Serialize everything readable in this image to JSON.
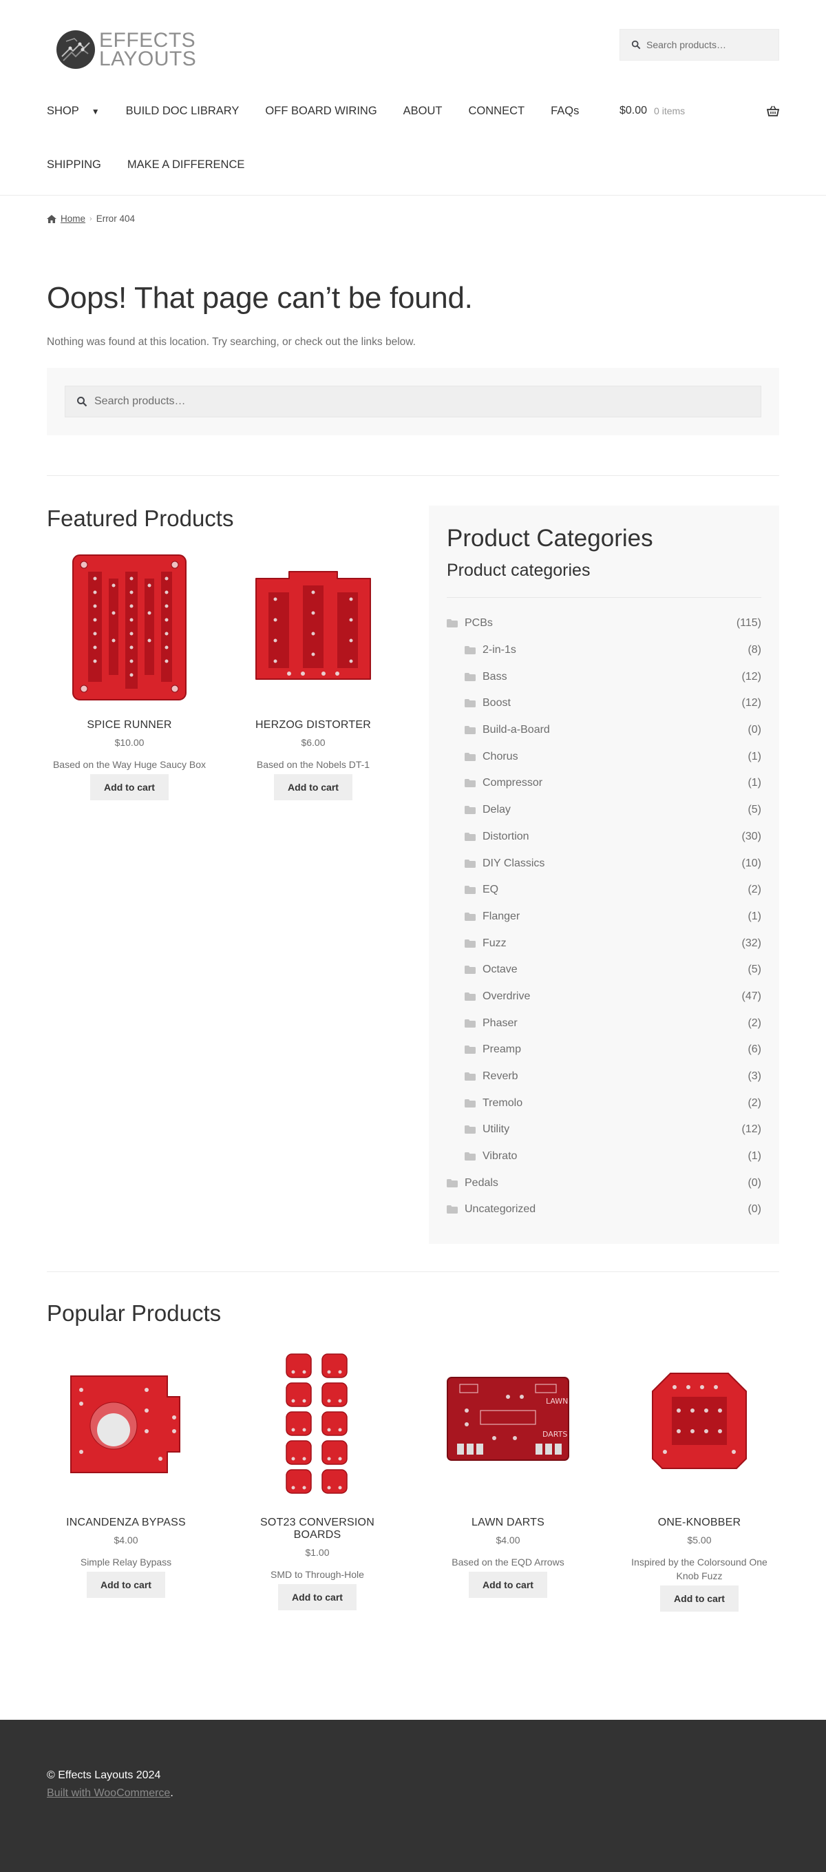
{
  "brand": {
    "line1": "EFFECTS",
    "line2": "LAYOUTS"
  },
  "header_search": {
    "placeholder": "Search products…"
  },
  "nav": {
    "row1": [
      "SHOP",
      "BUILD DOC LIBRARY",
      "OFF BOARD WIRING",
      "ABOUT",
      "CONNECT",
      "FAQs"
    ],
    "row2": [
      "SHIPPING",
      "MAKE A DIFFERENCE"
    ]
  },
  "cart": {
    "total": "$0.00",
    "items": "0 items"
  },
  "breadcrumb": {
    "home": "Home",
    "current": "Error 404"
  },
  "error": {
    "title": "Oops! That page can’t be found.",
    "subtitle": "Nothing was found at this location. Try searching, or check out the links below.",
    "search_placeholder": "Search products…"
  },
  "featured": {
    "title": "Featured Products",
    "products": [
      {
        "name": "SPICE RUNNER",
        "price": "$10.00",
        "desc": "Based on the Way Huge Saucy Box",
        "button": "Add to cart"
      },
      {
        "name": "HERZOG DISTORTER",
        "price": "$6.00",
        "desc": "Based on the Nobels DT-1",
        "button": "Add to cart"
      }
    ]
  },
  "categories": {
    "title": "Product Categories",
    "subtitle": "Product categories",
    "items": [
      {
        "label": "PCBs",
        "count": "(115)",
        "child": false
      },
      {
        "label": "2-in-1s",
        "count": "(8)",
        "child": true
      },
      {
        "label": "Bass",
        "count": "(12)",
        "child": true
      },
      {
        "label": "Boost",
        "count": "(12)",
        "child": true
      },
      {
        "label": "Build-a-Board",
        "count": "(0)",
        "child": true
      },
      {
        "label": "Chorus",
        "count": "(1)",
        "child": true
      },
      {
        "label": "Compressor",
        "count": "(1)",
        "child": true
      },
      {
        "label": "Delay",
        "count": "(5)",
        "child": true
      },
      {
        "label": "Distortion",
        "count": "(30)",
        "child": true
      },
      {
        "label": "DIY Classics",
        "count": "(10)",
        "child": true
      },
      {
        "label": "EQ",
        "count": "(2)",
        "child": true
      },
      {
        "label": "Flanger",
        "count": "(1)",
        "child": true
      },
      {
        "label": "Fuzz",
        "count": "(32)",
        "child": true
      },
      {
        "label": "Octave",
        "count": "(5)",
        "child": true
      },
      {
        "label": "Overdrive",
        "count": "(47)",
        "child": true
      },
      {
        "label": "Phaser",
        "count": "(2)",
        "child": true
      },
      {
        "label": "Preamp",
        "count": "(6)",
        "child": true
      },
      {
        "label": "Reverb",
        "count": "(3)",
        "child": true
      },
      {
        "label": "Tremolo",
        "count": "(2)",
        "child": true
      },
      {
        "label": "Utility",
        "count": "(12)",
        "child": true
      },
      {
        "label": "Vibrato",
        "count": "(1)",
        "child": true
      },
      {
        "label": "Pedals",
        "count": "(0)",
        "child": false
      },
      {
        "label": "Uncategorized",
        "count": "(0)",
        "child": false
      }
    ]
  },
  "popular": {
    "title": "Popular Products",
    "products": [
      {
        "name": "INCANDENZA BYPASS",
        "price": "$4.00",
        "desc": "Simple Relay Bypass",
        "button": "Add to cart"
      },
      {
        "name": "SOT23 CONVERSION BOARDS",
        "price": "$1.00",
        "desc": "SMD to Through-Hole",
        "button": "Add to cart"
      },
      {
        "name": "LAWN DARTS",
        "price": "$4.00",
        "desc": "Based on the EQD Arrows",
        "button": "Add to cart"
      },
      {
        "name": "ONE-KNOBBER",
        "price": "$5.00",
        "desc": "Inspired by the Colorsound One Knob Fuzz",
        "button": "Add to cart"
      }
    ]
  },
  "pcb_labels": {
    "lawn": "LAWN",
    "darts": "DARTS"
  },
  "footer": {
    "copyright": "© Effects Layouts 2024",
    "built_link": "Built with WooCommerce",
    "built_dot": "."
  },
  "colors": {
    "pcb_red": "#d8232a",
    "pcb_dark": "#a01018",
    "footer_bg": "#333333",
    "panel_bg": "#f8f8f8"
  }
}
